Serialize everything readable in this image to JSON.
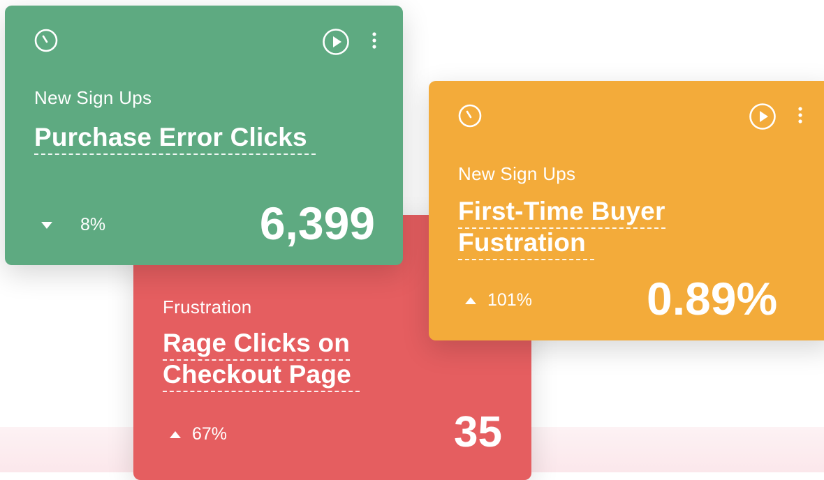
{
  "colors": {
    "green_card": "#5eaa81",
    "red_card": "#e55e60",
    "orange_card": "#f3ab3a",
    "text": "#ffffff"
  },
  "cards": [
    {
      "id": "green",
      "category": "New Sign Ups",
      "title": "Purchase Error Clicks",
      "trend_direction": "down",
      "trend_percent": "8%",
      "metric": "6,399",
      "icons": [
        "clock-icon",
        "play-icon",
        "more-vertical-icon"
      ]
    },
    {
      "id": "red",
      "category": "Frustration",
      "title": "Rage Clicks on Checkout Page",
      "trend_direction": "up",
      "trend_percent": "67%",
      "metric": "35",
      "icons": []
    },
    {
      "id": "orange",
      "category": "New Sign Ups",
      "title": "First-Time Buyer Fustration",
      "trend_direction": "up",
      "trend_percent": "101%",
      "metric": "0.89%",
      "icons": [
        "clock-icon",
        "play-icon",
        "more-vertical-icon"
      ]
    }
  ]
}
